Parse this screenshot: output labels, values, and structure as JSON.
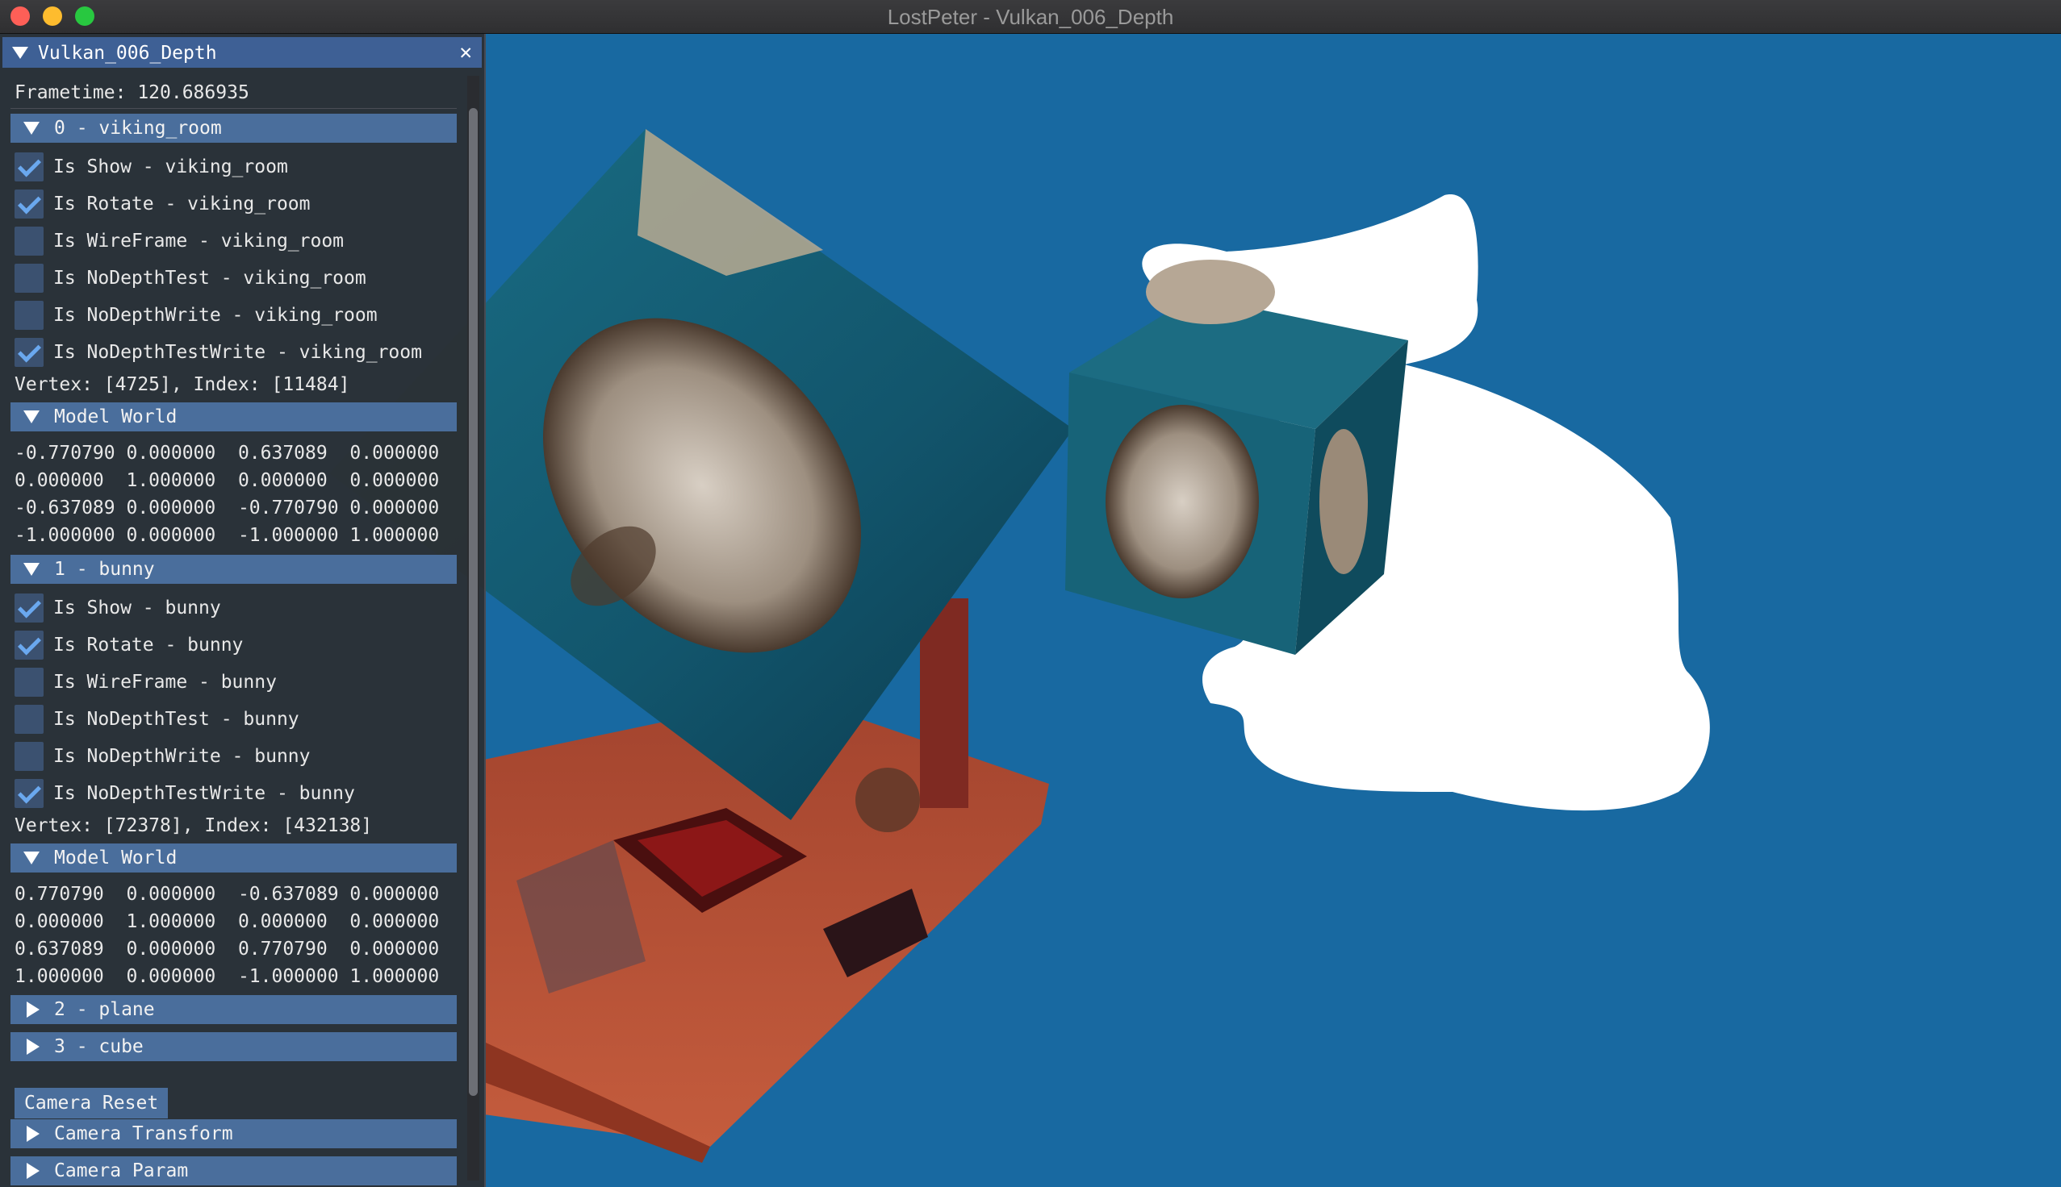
{
  "window": {
    "title": "LostPeter - Vulkan_006_Depth"
  },
  "panel": {
    "title": "Vulkan_006_Depth",
    "frametime": "Frametime: 120.686935",
    "objects": [
      {
        "header": "0 - viking_room",
        "checks": [
          {
            "label": "Is Show - viking_room",
            "checked": true
          },
          {
            "label": "Is Rotate - viking_room",
            "checked": true
          },
          {
            "label": "Is WireFrame - viking_room",
            "checked": false
          },
          {
            "label": "Is NoDepthTest - viking_room",
            "checked": false
          },
          {
            "label": "Is NoDepthWrite - viking_room",
            "checked": false
          },
          {
            "label": "Is NoDepthTestWrite - viking_room",
            "checked": true
          }
        ],
        "stats": "Vertex: [4725], Index: [11484]",
        "model_header": "Model World",
        "matrix": [
          "-0.770790 0.000000  0.637089  0.000000",
          "0.000000  1.000000  0.000000  0.000000",
          "-0.637089 0.000000  -0.770790 0.000000",
          "-1.000000 0.000000  -1.000000 1.000000"
        ]
      },
      {
        "header": "1 - bunny",
        "checks": [
          {
            "label": "Is Show - bunny",
            "checked": true
          },
          {
            "label": "Is Rotate - bunny",
            "checked": true
          },
          {
            "label": "Is WireFrame - bunny",
            "checked": false
          },
          {
            "label": "Is NoDepthTest - bunny",
            "checked": false
          },
          {
            "label": "Is NoDepthWrite - bunny",
            "checked": false
          },
          {
            "label": "Is NoDepthTestWrite - bunny",
            "checked": true
          }
        ],
        "stats": "Vertex: [72378], Index: [432138]",
        "model_header": "Model World",
        "matrix": [
          "0.770790  0.000000  -0.637089 0.000000",
          "0.000000  1.000000  0.000000  0.000000",
          "0.637089  0.000000  0.770790  0.000000",
          "1.000000  0.000000  -1.000000 1.000000"
        ]
      }
    ],
    "collapsed": [
      "2 - plane",
      "3 - cube"
    ],
    "camera_reset": "Camera Reset",
    "camera_sections": [
      "Camera Transform",
      "Camera Param"
    ]
  },
  "colors": {
    "background": "#1869a1",
    "header": "#4a6e9c",
    "title": "#3e6095",
    "check": "#6aa8ef"
  }
}
